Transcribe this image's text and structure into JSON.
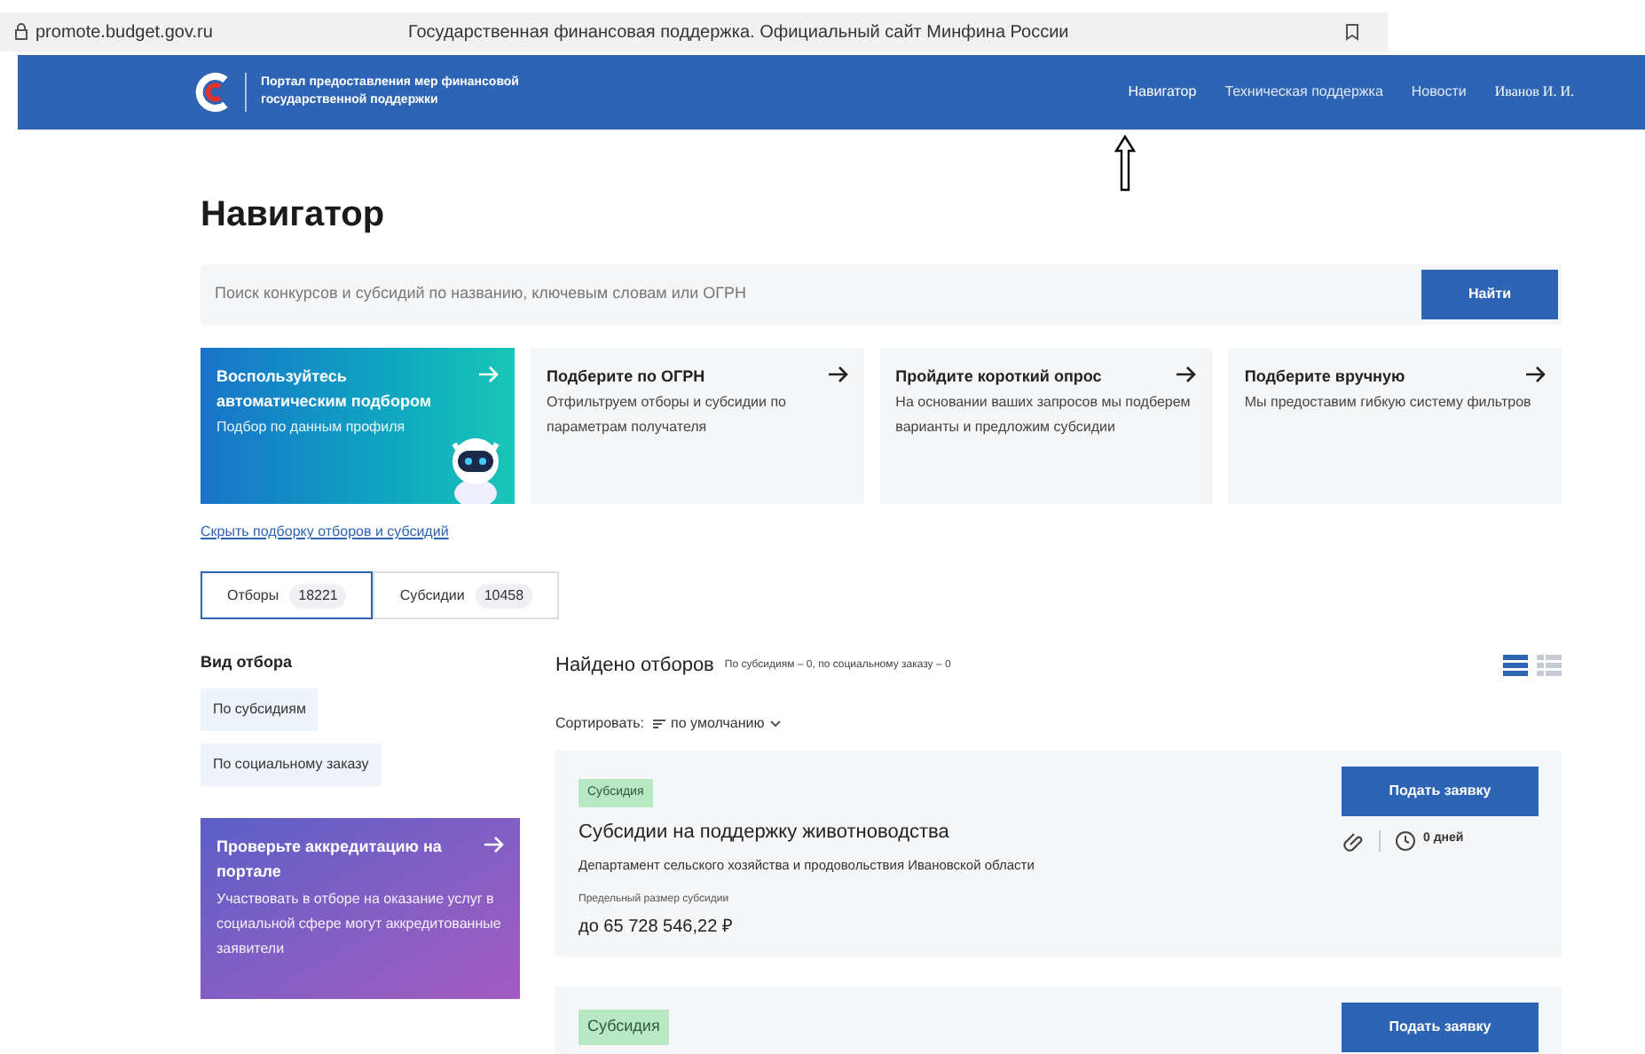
{
  "browser": {
    "url": "promote.budget.gov.ru",
    "page_title": "Государственная финансовая поддержка. Официальный сайт Минфина России"
  },
  "header": {
    "portal_name": "Портал предоставления мер финансовой государственной поддержки",
    "nav": [
      {
        "label": "Навигатор",
        "selected": true
      },
      {
        "label": "Техническая поддержка",
        "selected": false
      },
      {
        "label": "Новости",
        "selected": false
      }
    ],
    "user": "Иванов И. И."
  },
  "page_title": "Навигатор",
  "search": {
    "placeholder": "Поиск конкурсов и субсидий по названию, ключевым словам или ОГРН",
    "button": "Найти"
  },
  "promo_cards": [
    {
      "kind": "featured",
      "title": "Воспользуйтесь автоматическим подбором",
      "text": "Подбор по данным профиля"
    },
    {
      "kind": "plain",
      "title": "Подберите по ОГРН",
      "text": "Отфильтруем отборы и субсидии по параметрам получателя"
    },
    {
      "kind": "plain",
      "title": "Пройдите короткий опрос",
      "text": "На основании ваших запросов мы подберем варианты и предложим субсидии"
    },
    {
      "kind": "plain",
      "title": "Подберите вручную",
      "text": "Мы предоставим гибкую систему фильтров"
    }
  ],
  "hide_link": "Скрыть подборку отборов и субсидий",
  "tabs": [
    {
      "label": "Отборы",
      "count": "18221",
      "selected": true
    },
    {
      "label": "Субсидии",
      "count": "10458",
      "selected": false
    }
  ],
  "filter": {
    "title": "Вид отбора",
    "options": [
      "По субсидиям",
      "По социальному заказу"
    ]
  },
  "accreditation": {
    "title": "Проверьте аккредитацию на портале",
    "text": "Участвовать в отборе на оказание услуг в социальной сфере могут аккредитованные заявители"
  },
  "results": {
    "title": "Найдено отборов",
    "subtitle": "По субсидиям – 0, по социальному заказу – 0",
    "sort_label": "Сортировать:",
    "sort_value": "по умолчанию",
    "view_modes": [
      {
        "kind": "list",
        "selected": true
      },
      {
        "kind": "grid",
        "selected": false
      }
    ]
  },
  "items": [
    {
      "tag": "Субсидия",
      "button": "Подать заявку",
      "title": "Субсидии на поддержку животноводства",
      "org": "Департамент сельского хозяйства и продовольствия Ивановской области",
      "days": "0 дней",
      "limit_label": "Предельный размер субсидии",
      "limit": "до 65 728 546,22 ₽"
    },
    {
      "tag": "Субсидия",
      "button": "Подать заявку"
    }
  ]
}
